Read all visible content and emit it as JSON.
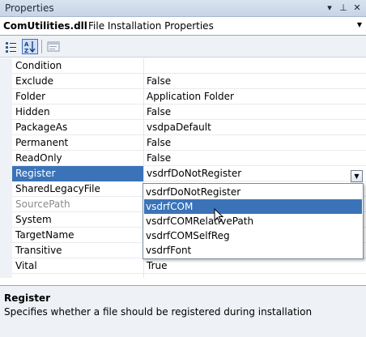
{
  "window": {
    "title": "Properties",
    "buttons": {
      "dropdown": "▾",
      "pin": "⊥",
      "close": "✕"
    }
  },
  "object_selector": {
    "name": "ComUtilities.dll",
    "type": "File Installation Properties",
    "arrow": "▼"
  },
  "toolbar": {
    "buttons": [
      {
        "name": "categorized",
        "icon": "categorized-icon",
        "active": false
      },
      {
        "name": "alphabetical",
        "icon": "alphabetical-sort-icon",
        "active": true
      },
      {
        "name": "property-pages",
        "icon": "property-pages-icon",
        "active": false
      }
    ]
  },
  "properties": [
    {
      "name": "Condition",
      "value": ""
    },
    {
      "name": "Exclude",
      "value": "False"
    },
    {
      "name": "Folder",
      "value": "Application Folder"
    },
    {
      "name": "Hidden",
      "value": "False"
    },
    {
      "name": "PackageAs",
      "value": "vsdpaDefault"
    },
    {
      "name": "Permanent",
      "value": "False"
    },
    {
      "name": "ReadOnly",
      "value": "False"
    },
    {
      "name": "Register",
      "value": "vsdrfDoNotRegister",
      "selected": true
    },
    {
      "name": "SharedLegacyFile",
      "value": ""
    },
    {
      "name": "SourcePath",
      "value": "",
      "disabled": true
    },
    {
      "name": "System",
      "value": ""
    },
    {
      "name": "TargetName",
      "value": ""
    },
    {
      "name": "Transitive",
      "value": ""
    },
    {
      "name": "Vital",
      "value": "True"
    }
  ],
  "dropdown": {
    "arrow": "▼",
    "options": [
      "vsdrfDoNotRegister",
      "vsdrfCOM",
      "vsdrfCOMRelativePath",
      "vsdrfCOMSelfReg",
      "vsdrfFont"
    ],
    "hovered": "vsdrfCOM"
  },
  "description": {
    "title": "Register",
    "text": "Specifies whether a file should be registered during installation"
  },
  "colors": {
    "selection": "#3b73b9",
    "panel": "#eef1f6"
  }
}
